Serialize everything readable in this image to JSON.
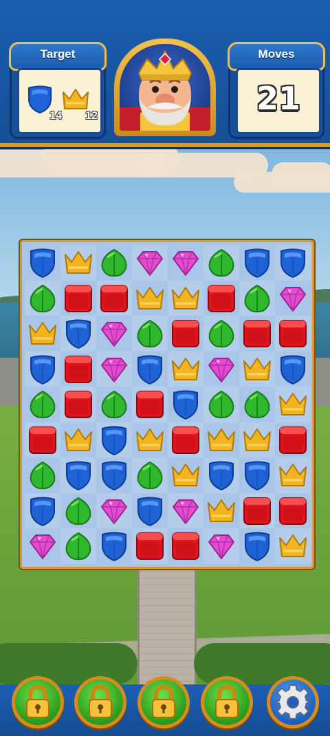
{
  "hud": {
    "target_label": "Target",
    "moves_label": "Moves",
    "moves_left": "21",
    "targets": [
      {
        "icon": "blue-shield-icon",
        "count": "14"
      },
      {
        "icon": "gold-crown-icon",
        "count": "12"
      }
    ],
    "portrait": "king-portrait"
  },
  "board": {
    "rows": 9,
    "cols": 8,
    "grid": [
      [
        "shield",
        "crown",
        "leaf",
        "gem",
        "gem",
        "leaf",
        "shield",
        "shield"
      ],
      [
        "leaf",
        "box",
        "box",
        "crown",
        "crown",
        "box",
        "leaf",
        "gem"
      ],
      [
        "crown",
        "shield",
        "gem",
        "leaf",
        "box",
        "leaf",
        "box",
        "box"
      ],
      [
        "shield",
        "box",
        "gem",
        "shield",
        "crown",
        "gem",
        "crown",
        "shield"
      ],
      [
        "leaf",
        "box",
        "leaf",
        "box",
        "shield",
        "leaf",
        "leaf",
        "crown"
      ],
      [
        "box",
        "crown",
        "shield",
        "crown",
        "box",
        "crown",
        "crown",
        "box"
      ],
      [
        "leaf",
        "shield",
        "shield",
        "leaf",
        "crown",
        "shield",
        "shield",
        "crown"
      ],
      [
        "shield",
        "leaf",
        "gem",
        "shield",
        "gem",
        "crown",
        "box",
        "box"
      ],
      [
        "gem",
        "leaf",
        "shield",
        "box",
        "box",
        "gem",
        "shield",
        "crown"
      ]
    ]
  },
  "boosters": [
    {
      "name": "booster-1",
      "icon": "padlock-icon",
      "locked": true
    },
    {
      "name": "booster-2",
      "icon": "padlock-icon",
      "locked": true
    },
    {
      "name": "booster-3",
      "icon": "padlock-icon",
      "locked": true
    },
    {
      "name": "booster-4",
      "icon": "padlock-icon",
      "locked": true
    },
    {
      "name": "settings",
      "icon": "gear-icon"
    }
  ],
  "colors": {
    "shield": "#1f62d6",
    "crown": "#f2b51f",
    "leaf": "#2fb82d",
    "gem": "#e34bd3",
    "box": "#e0141c",
    "hud_blue": "#1a5fb0",
    "gold_trim": "#d99a2b"
  }
}
